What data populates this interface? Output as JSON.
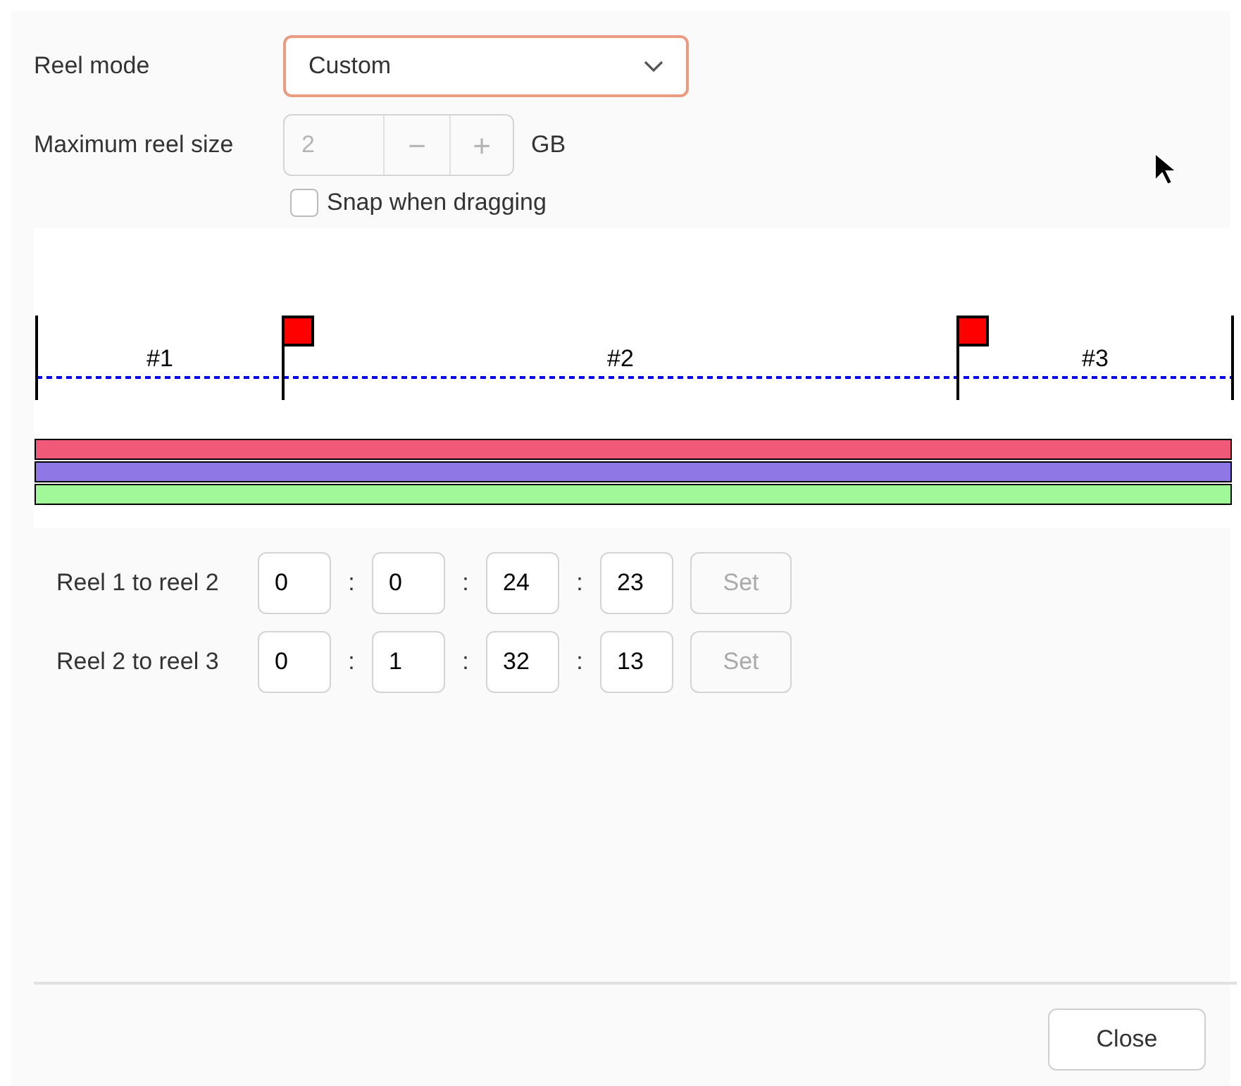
{
  "reel_mode": {
    "label": "Reel mode",
    "value": "Custom",
    "focused": true
  },
  "max_reel_size": {
    "label": "Maximum reel size",
    "value": "2",
    "disabled": true,
    "decrement": "−",
    "increment": "+",
    "unit": "GB"
  },
  "snap": {
    "label": "Snap when dragging",
    "checked": false
  },
  "timeline": {
    "reels": [
      {
        "label": "#1"
      },
      {
        "label": "#2"
      },
      {
        "label": "#3"
      }
    ],
    "tracks": [
      {
        "color": "#f05a78"
      },
      {
        "color": "#9077e6"
      },
      {
        "color": "#a0f898"
      }
    ]
  },
  "boundaries": [
    {
      "label": "Reel 1 to reel 2",
      "fields": [
        "0",
        "0",
        "24",
        "23"
      ],
      "separator": ":",
      "set": {
        "label": "Set",
        "disabled": true
      }
    },
    {
      "label": "Reel 2 to reel 3",
      "fields": [
        "0",
        "1",
        "32",
        "13"
      ],
      "separator": ":",
      "set": {
        "label": "Set",
        "disabled": true
      }
    }
  ],
  "close": "Close"
}
